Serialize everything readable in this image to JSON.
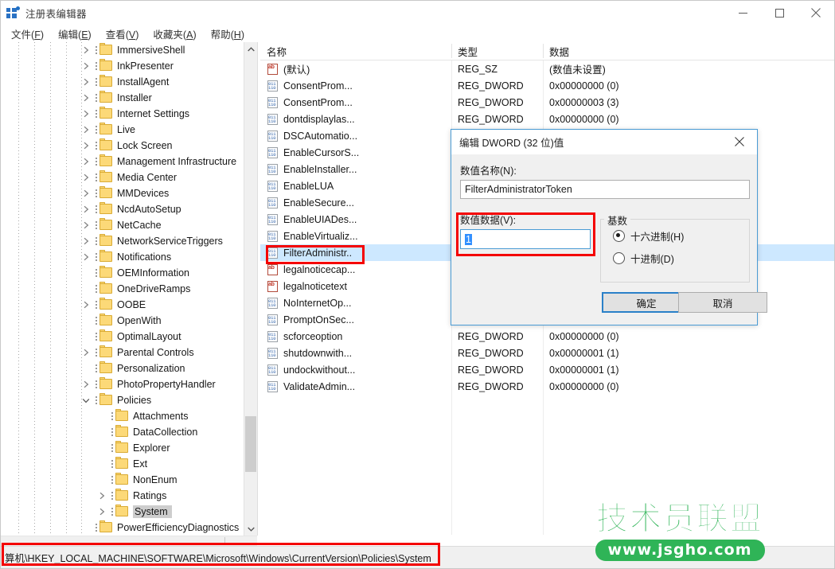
{
  "window": {
    "title": "注册表编辑器",
    "icon": "registry-editor-icon",
    "minimize_label": "最小化",
    "maximize_label": "最大化",
    "close_label": "关闭"
  },
  "menu": [
    {
      "label": "文件(F)",
      "text": "文件",
      "accel": "F"
    },
    {
      "label": "编辑(E)",
      "text": "编辑",
      "accel": "E"
    },
    {
      "label": "查看(V)",
      "text": "查看",
      "accel": "V"
    },
    {
      "label": "收藏夹(A)",
      "text": "收藏夹",
      "accel": "A"
    },
    {
      "label": "帮助(H)",
      "text": "帮助",
      "accel": "H"
    }
  ],
  "tree": {
    "nodes": [
      {
        "label": "ImmersiveShell",
        "depth": 1,
        "expandable": true,
        "expanded": false,
        "selected": false
      },
      {
        "label": "InkPresenter",
        "depth": 1,
        "expandable": true,
        "expanded": false,
        "selected": false
      },
      {
        "label": "InstallAgent",
        "depth": 1,
        "expandable": true,
        "expanded": false,
        "selected": false
      },
      {
        "label": "Installer",
        "depth": 1,
        "expandable": true,
        "expanded": false,
        "selected": false
      },
      {
        "label": "Internet Settings",
        "depth": 1,
        "expandable": true,
        "expanded": false,
        "selected": false
      },
      {
        "label": "Live",
        "depth": 1,
        "expandable": true,
        "expanded": false,
        "selected": false
      },
      {
        "label": "Lock Screen",
        "depth": 1,
        "expandable": true,
        "expanded": false,
        "selected": false
      },
      {
        "label": "Management Infrastructure",
        "depth": 1,
        "expandable": true,
        "expanded": false,
        "selected": false
      },
      {
        "label": "Media Center",
        "depth": 1,
        "expandable": true,
        "expanded": false,
        "selected": false
      },
      {
        "label": "MMDevices",
        "depth": 1,
        "expandable": true,
        "expanded": false,
        "selected": false
      },
      {
        "label": "NcdAutoSetup",
        "depth": 1,
        "expandable": true,
        "expanded": false,
        "selected": false
      },
      {
        "label": "NetCache",
        "depth": 1,
        "expandable": true,
        "expanded": false,
        "selected": false
      },
      {
        "label": "NetworkServiceTriggers",
        "depth": 1,
        "expandable": true,
        "expanded": false,
        "selected": false
      },
      {
        "label": "Notifications",
        "depth": 1,
        "expandable": true,
        "expanded": false,
        "selected": false
      },
      {
        "label": "OEMInformation",
        "depth": 1,
        "expandable": false,
        "expanded": false,
        "selected": false
      },
      {
        "label": "OneDriveRamps",
        "depth": 1,
        "expandable": false,
        "expanded": false,
        "selected": false
      },
      {
        "label": "OOBE",
        "depth": 1,
        "expandable": true,
        "expanded": false,
        "selected": false
      },
      {
        "label": "OpenWith",
        "depth": 1,
        "expandable": false,
        "expanded": false,
        "selected": false
      },
      {
        "label": "OptimalLayout",
        "depth": 1,
        "expandable": false,
        "expanded": false,
        "selected": false
      },
      {
        "label": "Parental Controls",
        "depth": 1,
        "expandable": true,
        "expanded": false,
        "selected": false
      },
      {
        "label": "Personalization",
        "depth": 1,
        "expandable": false,
        "expanded": false,
        "selected": false
      },
      {
        "label": "PhotoPropertyHandler",
        "depth": 1,
        "expandable": true,
        "expanded": false,
        "selected": false
      },
      {
        "label": "Policies",
        "depth": 1,
        "expandable": true,
        "expanded": true,
        "selected": false
      },
      {
        "label": "Attachments",
        "depth": 2,
        "expandable": false,
        "expanded": false,
        "selected": false
      },
      {
        "label": "DataCollection",
        "depth": 2,
        "expandable": false,
        "expanded": false,
        "selected": false
      },
      {
        "label": "Explorer",
        "depth": 2,
        "expandable": false,
        "expanded": false,
        "selected": false
      },
      {
        "label": "Ext",
        "depth": 2,
        "expandable": false,
        "expanded": false,
        "selected": false
      },
      {
        "label": "NonEnum",
        "depth": 2,
        "expandable": false,
        "expanded": false,
        "selected": false
      },
      {
        "label": "Ratings",
        "depth": 2,
        "expandable": true,
        "expanded": false,
        "selected": false
      },
      {
        "label": "System",
        "depth": 2,
        "expandable": true,
        "expanded": false,
        "selected": true
      },
      {
        "label": "PowerEfficiencyDiagnostics",
        "depth": 1,
        "expandable": false,
        "expanded": false,
        "selected": false
      }
    ]
  },
  "list": {
    "columns": [
      {
        "label": "名称",
        "key": "name"
      },
      {
        "label": "类型",
        "key": "type"
      },
      {
        "label": "数据",
        "key": "data"
      }
    ],
    "rows": [
      {
        "name": "(默认)",
        "type": "REG_SZ",
        "data": "(数值未设置)",
        "icon": "string-value-icon",
        "selected": false
      },
      {
        "name": "ConsentProm...",
        "type": "REG_DWORD",
        "data": "0x00000000 (0)",
        "icon": "dword-value-icon",
        "selected": false
      },
      {
        "name": "ConsentProm...",
        "type": "REG_DWORD",
        "data": "0x00000003 (3)",
        "icon": "dword-value-icon",
        "selected": false
      },
      {
        "name": "dontdisplaylas...",
        "type": "REG_DWORD",
        "data": "0x00000000 (0)",
        "icon": "dword-value-icon",
        "selected": false
      },
      {
        "name": "DSCAutomatio...",
        "type": "REG_DWORD",
        "data": "",
        "icon": "dword-value-icon",
        "selected": false
      },
      {
        "name": "EnableCursorS...",
        "type": "REG_DWORD",
        "data": "",
        "icon": "dword-value-icon",
        "selected": false
      },
      {
        "name": "EnableInstaller...",
        "type": "REG_DWORD",
        "data": "",
        "icon": "dword-value-icon",
        "selected": false
      },
      {
        "name": "EnableLUA",
        "type": "REG_DWORD",
        "data": "",
        "icon": "dword-value-icon",
        "selected": false
      },
      {
        "name": "EnableSecure...",
        "type": "REG_DWORD",
        "data": "",
        "icon": "dword-value-icon",
        "selected": false
      },
      {
        "name": "EnableUIADes...",
        "type": "REG_DWORD",
        "data": "",
        "icon": "dword-value-icon",
        "selected": false
      },
      {
        "name": "EnableVirtualiz...",
        "type": "REG_DWORD",
        "data": "",
        "icon": "dword-value-icon",
        "selected": false
      },
      {
        "name": "FilterAdministr..",
        "type": "REG_DWORD",
        "data": "",
        "icon": "dword-value-icon",
        "selected": true
      },
      {
        "name": "legalnoticecap...",
        "type": "REG_SZ",
        "data": "",
        "icon": "string-value-icon",
        "selected": false
      },
      {
        "name": "legalnoticetext",
        "type": "REG_SZ",
        "data": "",
        "icon": "string-value-icon",
        "selected": false
      },
      {
        "name": "NoInternetOp...",
        "type": "REG_DWORD",
        "data": "",
        "icon": "dword-value-icon",
        "selected": false
      },
      {
        "name": "PromptOnSec...",
        "type": "REG_DWORD",
        "data": "",
        "icon": "dword-value-icon",
        "selected": false
      },
      {
        "name": "scforceoption",
        "type": "REG_DWORD",
        "data": "0x00000000 (0)",
        "icon": "dword-value-icon",
        "selected": false
      },
      {
        "name": "shutdownwith...",
        "type": "REG_DWORD",
        "data": "0x00000001 (1)",
        "icon": "dword-value-icon",
        "selected": false
      },
      {
        "name": "undockwithout...",
        "type": "REG_DWORD",
        "data": "0x00000001 (1)",
        "icon": "dword-value-icon",
        "selected": false
      },
      {
        "name": "ValidateAdmin...",
        "type": "REG_DWORD",
        "data": "0x00000000 (0)",
        "icon": "dword-value-icon",
        "selected": false
      }
    ]
  },
  "dialog": {
    "title": "编辑 DWORD (32 位)值",
    "close_label": "关闭",
    "name_label": "数值名称(N):",
    "name_value": "FilterAdministratorToken",
    "data_label": "数值数据(V):",
    "data_value": "1",
    "base_group_label": "基数",
    "radios": [
      {
        "label": "十六进制(H)",
        "checked": true
      },
      {
        "label": "十进制(D)",
        "checked": false
      }
    ],
    "ok_label": "确定",
    "cancel_label": "取消"
  },
  "statusbar": {
    "path": "算机\\HKEY_LOCAL_MACHINE\\SOFTWARE\\Microsoft\\Windows\\CurrentVersion\\Policies\\System"
  },
  "watermark": {
    "brand": "技术员联盟",
    "url": "www.jsgho.com",
    "color": "#2fb457"
  },
  "colors": {
    "annotation": "#f40000",
    "selection": "#cde8ff",
    "tree_selection": "#cdcdcd",
    "accent": "#2a80c8"
  }
}
